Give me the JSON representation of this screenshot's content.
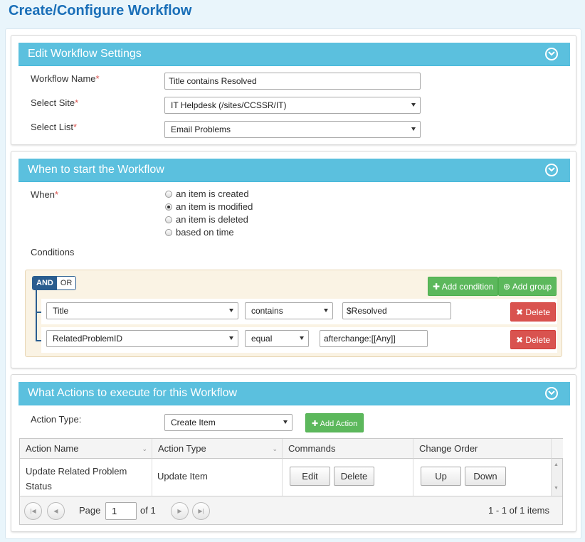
{
  "page_title": "Create/Configure Workflow",
  "settings": {
    "header": "Edit Workflow Settings",
    "name_label": "Workflow Name",
    "name_value": "Title contains Resolved",
    "site_label": "Select Site",
    "site_value": "IT Helpdesk (/sites/CCSSR/IT)",
    "list_label": "Select List",
    "list_value": "Email Problems",
    "required_mark": "*"
  },
  "trigger": {
    "header": "When to start the Workflow",
    "when_label": "When",
    "options": [
      {
        "label": "an item is created",
        "selected": false
      },
      {
        "label": "an item is modified",
        "selected": true
      },
      {
        "label": "an item is deleted",
        "selected": false
      },
      {
        "label": "based on time",
        "selected": false
      }
    ],
    "conditions_label": "Conditions",
    "and_label": "AND",
    "or_label": "OR",
    "add_condition": "Add condition",
    "add_group": "Add group",
    "rules": [
      {
        "field": "Title",
        "operator": "contains",
        "value": "$Resolved",
        "delete": "Delete"
      },
      {
        "field": "RelatedProblemID",
        "operator": "equal",
        "value": "afterchange:[[Any]]",
        "delete": "Delete"
      }
    ]
  },
  "actions": {
    "header": "What Actions to execute for this Workflow",
    "type_label": "Action Type:",
    "type_value": "Create Item",
    "add_action": "Add Action",
    "columns": [
      "Action Name",
      "Action Type",
      "Commands",
      "Change Order"
    ],
    "rows": [
      {
        "name_line1": "Update Related Problem",
        "name_line2": "Status",
        "type": "Update Item",
        "edit": "Edit",
        "delete": "Delete",
        "up": "Up",
        "down": "Down"
      }
    ],
    "pager": {
      "page_label": "Page",
      "page_value": "1",
      "of_label": "of 1",
      "summary": "1 - 1 of 1 items"
    }
  },
  "colors": {
    "title": "#1a6fb8",
    "panel_header": "#5bc0de",
    "green": "#5cb85c",
    "red": "#d9534f",
    "navy": "#2a5d8f"
  }
}
